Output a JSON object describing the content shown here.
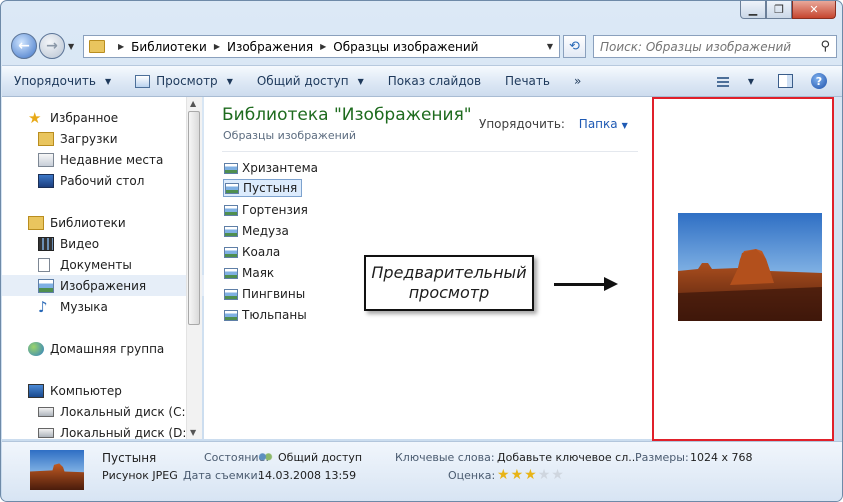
{
  "window": {
    "caption": {
      "minimize": "▁",
      "maximize": "❐",
      "close": "✕"
    }
  },
  "nav": {
    "breadcrumb": [
      "Библиотеки",
      "Изображения",
      "Образцы изображений"
    ],
    "search_placeholder": "Поиск: Образцы изображений"
  },
  "toolbar": {
    "organize": "Упорядочить",
    "view": "Просмотр",
    "share": "Общий доступ",
    "slideshow": "Показ слайдов",
    "print": "Печать",
    "more": "»"
  },
  "sidebar": {
    "items": [
      {
        "label": "Избранное",
        "icon": "star-icon"
      },
      {
        "label": "Загрузки",
        "icon": "downloads-folder-icon"
      },
      {
        "label": "Недавние места",
        "icon": "recent-places-icon"
      },
      {
        "label": "Рабочий стол",
        "icon": "desktop-icon"
      },
      {
        "label": "Библиотеки",
        "icon": "libraries-icon"
      },
      {
        "label": "Видео",
        "icon": "video-icon"
      },
      {
        "label": "Документы",
        "icon": "documents-icon"
      },
      {
        "label": "Изображения",
        "icon": "pictures-icon",
        "selected": true
      },
      {
        "label": "Музыка",
        "icon": "music-icon"
      },
      {
        "label": "Домашняя группа",
        "icon": "homegroup-icon"
      },
      {
        "label": "Компьютер",
        "icon": "computer-icon"
      },
      {
        "label": "Локальный диск (C:)",
        "icon": "drive-c-icon"
      },
      {
        "label": "Локальный диск (D:)",
        "icon": "drive-d-icon"
      }
    ]
  },
  "content": {
    "title": "Библиотека \"Изображения\"",
    "subtitle": "Образцы изображений",
    "arrange_label": "Упорядочить:",
    "arrange_value": "Папка",
    "files": [
      "Хризантема",
      "Пустыня",
      "Гортензия",
      "Медуза",
      "Коала",
      "Маяк",
      "Пингвины",
      "Тюльпаны"
    ],
    "selected_file": "Пустыня"
  },
  "callout": {
    "line1": "Предварительный",
    "line2": "просмотр"
  },
  "details": {
    "file_name": "Пустыня",
    "file_type": "Рисунок JPEG",
    "state_label": "Состояние:",
    "state_value": "Общий доступ",
    "date_label": "Дата съемки:",
    "date_value": "14.03.2008 13:59",
    "keywords_label": "Ключевые слова:",
    "keywords_value": "Добавьте ключевое сл...",
    "dimensions_label": "Размеры:",
    "dimensions_value": "1024 x 768",
    "rating_label": "Оценка:",
    "rating": 3,
    "rating_max": 5
  },
  "colors": {
    "preview_border": "#e0202a",
    "title_green": "#1e6b1e",
    "link_blue": "#1f5ab4"
  }
}
